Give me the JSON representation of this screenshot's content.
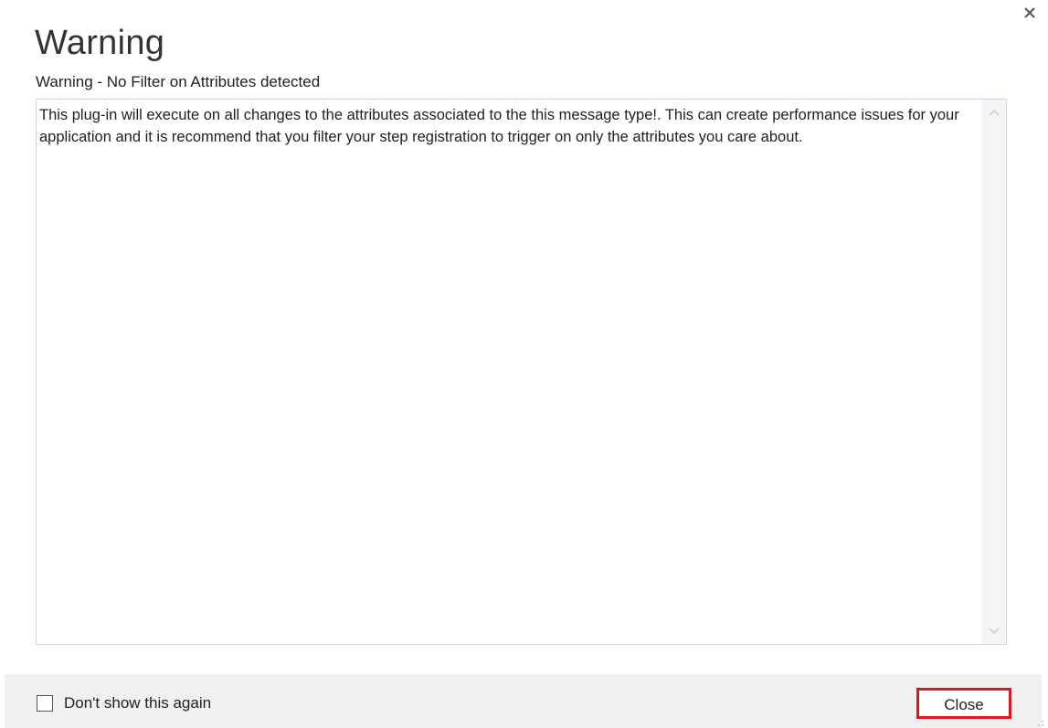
{
  "dialog": {
    "title": "Warning",
    "subtitle": "Warning - No Filter on Attributes detected",
    "message": "This plug-in will execute on all changes to the attributes associated to the this message type!. This can create performance issues for your application and it is recommend that you filter your step registration to trigger on only the attributes you care about."
  },
  "footer": {
    "checkbox_label": "Don't show this again",
    "checkbox_checked": false,
    "close_label": "Close"
  },
  "icons": {
    "dismiss": "close-icon",
    "scroll_up": "chevron-up-icon",
    "scroll_down": "chevron-down-icon",
    "resize": "resize-grip-icon"
  },
  "colors": {
    "highlight_border": "#e0161e",
    "textbox_border": "#c9d7e6",
    "footer_background": "#f0f0f0"
  }
}
